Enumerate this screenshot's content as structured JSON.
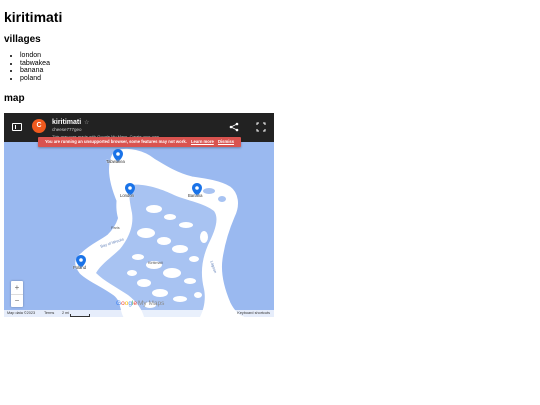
{
  "page": {
    "title": "kiritimati",
    "villages_heading": "villages",
    "map_heading": "map"
  },
  "villages": [
    "london",
    "tabwakea",
    "banana",
    "poland"
  ],
  "map": {
    "title": "kiritimati",
    "owner": "cheese777geo",
    "avatar_letter": "C",
    "info_text": "This map was made with Google My Maps. Create your own.",
    "warning": "You are running an unsupported browser, some features may not work.",
    "warning_link_1": "Learn more",
    "warning_link_2": "Dismiss",
    "pins": {
      "tabwakea": "Tabwakea",
      "london": "London",
      "banana": "Banana",
      "poland": "Poland"
    },
    "labels": {
      "paris": "Paris",
      "bay": "Bay of Wrecks",
      "kiritimati": "Kiritimati",
      "lagoon": "Lagoon"
    },
    "zoom_in": "+",
    "zoom_out": "−",
    "google_letters": [
      "G",
      "o",
      "o",
      "g",
      "l",
      "e"
    ],
    "my_maps": "My Maps",
    "footer": {
      "data": "Map data ©2023",
      "terms": "Terms",
      "scale": "2 mi",
      "shortcuts": "Keyboard shortcuts"
    },
    "colors": {
      "water": "#9ab9f0",
      "land": "#ffffff",
      "lagoon": "#a8c3f2",
      "pin": "#1a73e8",
      "topbar": "#222222",
      "banner": "#d9534f"
    }
  }
}
